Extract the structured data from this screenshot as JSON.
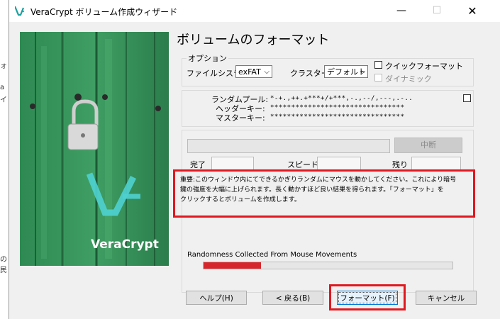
{
  "background_window": {
    "fragments": [
      "ォ",
      "a",
      "イ",
      "の",
      "民"
    ]
  },
  "window": {
    "title": "VeraCrypt ボリューム作成ウィザード"
  },
  "titlebar": {
    "min": "—",
    "max": "☐",
    "close": "✕"
  },
  "hero": {
    "brand": "VeraCrypt"
  },
  "page": {
    "title": "ボリュームのフォーマット"
  },
  "options": {
    "legend": "オプション",
    "filesystem_label": "ファイルシステ",
    "filesystem_value": "exFAT",
    "cluster_label": "クラスター",
    "cluster_value": "デフォルト",
    "quick_format": "クイックフォーマット",
    "dynamic": "ダイナミック"
  },
  "random": {
    "pool_label": "ランダムプール:",
    "pool_value": "*-+.,++.+***+/+***,-.,--/,---,.-..",
    "header_key_label": "ヘッダーキー:",
    "header_key_value": "********************************",
    "master_key_label": "マスターキー:",
    "master_key_value": "********************************"
  },
  "progress": {
    "abort": "中断",
    "done_label": "完了",
    "speed_label": "スピード",
    "left_label": "残り"
  },
  "info": {
    "line1": "重要:このウィンドウ内にてできるかぎりランダムにマウスを動かしてください。これにより暗号",
    "line2": "鍵の強度を大幅に上げられます。長く動かすほど良い結果を得られます。「フォーマット」を",
    "line3": "クリックするとボリュームを作成します。"
  },
  "randomness": {
    "label": "Randomness Collected From Mouse Movements",
    "fraction": 0.23
  },
  "buttons": {
    "help": "ヘルプ(H)",
    "back": "< 戻る(B)",
    "format": "フォーマット(F)",
    "cancel": "キャンセル"
  },
  "colors": {
    "highlight": "#e0181f",
    "progress_fill": "#d6262b",
    "accent": "#0078d7"
  }
}
